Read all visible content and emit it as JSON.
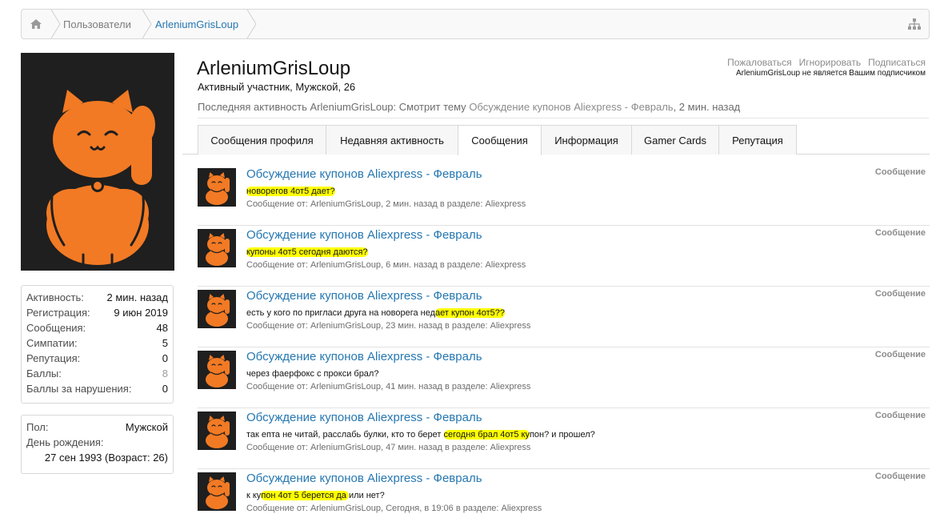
{
  "breadcrumb": {
    "home_icon": "home-icon",
    "items": [
      "Пользователи",
      "ArleniumGrisLoup"
    ],
    "sitemap_icon": "sitemap-icon"
  },
  "profile": {
    "username": "ArleniumGrisLoup",
    "title": "Активный участник, Мужской, 26",
    "actions": [
      "Пожаловаться",
      "Игнорировать",
      "Подписаться"
    ],
    "follow_note": "ArleniumGrisLoup не является Вашим подписчиком",
    "last_activity": {
      "prefix": "Последняя активность ArleniumGrisLoup:",
      "action": "Смотрит тему",
      "thread": "Обсуждение купонов Aliexpress - Февраль",
      "time": ", 2 мин. назад"
    }
  },
  "tabs": [
    "Сообщения профиля",
    "Недавняя активность",
    "Сообщения",
    "Информация",
    "Gamer Cards",
    "Репутация"
  ],
  "active_tab": "Сообщения",
  "stats": [
    {
      "label": "Активность:",
      "value": "2 мин. назад"
    },
    {
      "label": "Регистрация:",
      "value": "9 июн 2019"
    },
    {
      "label": "Сообщения:",
      "value": "48"
    },
    {
      "label": "Симпатии:",
      "value": "5"
    },
    {
      "label": "Репутация:",
      "value": "0"
    },
    {
      "label": "Баллы:",
      "value": "8"
    },
    {
      "label": "Баллы за нарушения:",
      "value": "0"
    }
  ],
  "info": {
    "gender_label": "Пол:",
    "gender_value": "Мужской",
    "birthday_label": "День рождения:",
    "birthday_value": "27 сен 1993 (Возраст: 26)"
  },
  "messages": [
    {
      "title": "Обсуждение купонов Aliexpress - Февраль",
      "snippet": [
        "",
        "новорегов 4от5 дает?",
        ""
      ],
      "meta": "Сообщение от: ArleniumGrisLoup, 2 мин. назад в разделе: Aliexpress",
      "type": "Сообщение"
    },
    {
      "title": "Обсуждение купонов Aliexpress - Февраль",
      "snippet": [
        "",
        "купоны 4от5 сегодня даются?",
        ""
      ],
      "meta": "Сообщение от: ArleniumGrisLoup, 6 мин. назад в разделе: Aliexpress",
      "type": "Сообщение"
    },
    {
      "title": "Обсуждение купонов Aliexpress - Февраль",
      "snippet": [
        "есть у кого по пригласи друга на новорега нед",
        "ает купон 4от5??",
        ""
      ],
      "meta": "Сообщение от: ArleniumGrisLoup, 23 мин. назад в разделе: Aliexpress",
      "type": "Сообщение"
    },
    {
      "title": "Обсуждение купонов Aliexpress - Февраль",
      "snippet": [
        "через фаерфокс с прокси брал?",
        "",
        ""
      ],
      "meta": "Сообщение от: ArleniumGrisLoup, 41 мин. назад в разделе: Aliexpress",
      "type": "Сообщение"
    },
    {
      "title": "Обсуждение купонов Aliexpress - Февраль",
      "snippet": [
        "так епта не читай, расслабь булки, кто то берет ",
        "сегодня брал 4от5 ку",
        "пон? и прошел?"
      ],
      "meta": "Сообщение от: ArleniumGrisLoup, 47 мин. назад в разделе: Aliexpress",
      "type": "Сообщение"
    },
    {
      "title": "Обсуждение купонов Aliexpress - Февраль",
      "snippet": [
        "к ку",
        "пон 4от 5 берется да ",
        "или нет?"
      ],
      "meta": "Сообщение от: ArleniumGrisLoup, Сегодня, в 19:06 в разделе: Aliexpress",
      "type": "Сообщение"
    }
  ],
  "colors": {
    "link": "#2577b1",
    "highlight": "#ffff00",
    "avatar_cat": "#f27a24",
    "avatar_bg": "#1f1f1f"
  }
}
